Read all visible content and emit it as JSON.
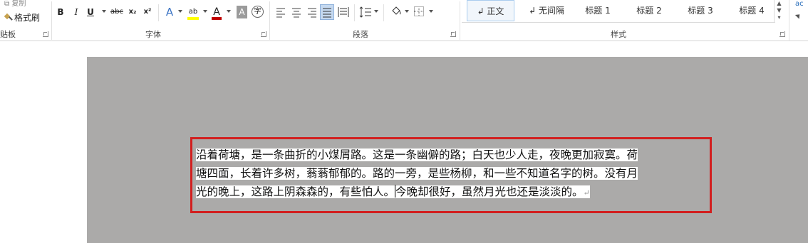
{
  "ribbon": {
    "clipboard": {
      "copy_label": "复制",
      "format_painter_label": "格式刷",
      "group_label": "贴板"
    },
    "font": {
      "bold": "B",
      "italic": "I",
      "underline": "U",
      "strikethrough": "abc",
      "subscript": "x₂",
      "superscript": "x²",
      "text_effects": "A",
      "highlight": "ab",
      "font_color": "A",
      "char_shading": "A",
      "enclose_char": "字",
      "group_label": "字体"
    },
    "paragraph": {
      "group_label": "段落"
    },
    "styles": {
      "items": [
        "↲ 正文",
        "↲ 无间隔",
        "标题 1",
        "标题 2",
        "标题 3",
        "标题 4"
      ],
      "active_index": 0,
      "group_label": "样式"
    },
    "editing": {
      "partial_label": "ac"
    }
  },
  "document": {
    "lines": [
      "沿着荷塘，是一条曲折的小煤屑路。这是一条幽僻的路；白天也少人走，夜晚更加寂寞。荷",
      "塘四面，长着许多树，蓊蓊郁郁的。路的一旁，是些杨柳，和一些不知道名字的树。没有月"
    ],
    "line3_before_cursor": "光的晚上，这路上阴森森的，有些怕人。",
    "line3_after_cursor": "今晚却很好，虽然月光也还是淡淡的。",
    "paragraph_mark": "↵"
  },
  "colors": {
    "canvas": "#abaaa9",
    "highlight_border": "#d21f1f",
    "font_color_bar": "#c00000",
    "highlight_bar": "#ffff00"
  },
  "icons": {
    "format_painter": "brush-icon",
    "paragraph_align": "align-icons",
    "line_spacing": "line-spacing-icon",
    "shading": "paint-bucket-icon",
    "borders": "border-icon"
  }
}
